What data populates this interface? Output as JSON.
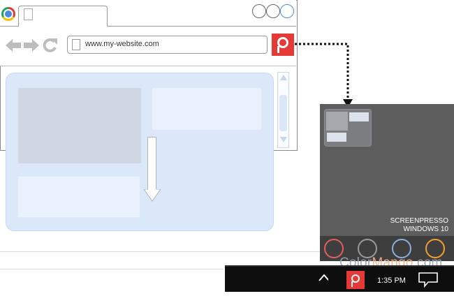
{
  "browser": {
    "url": "www.my-website.com",
    "window_buttons": [
      "minimize",
      "maximize",
      "close"
    ],
    "nav_icons": [
      "back-arrow-icon",
      "forward-arrow-icon",
      "reload-icon"
    ]
  },
  "notification": {
    "title_line1": "SCREENPRESSO",
    "title_line2": "WINDOWS 10",
    "action_colors": [
      "#e06060",
      "#9a9a9a",
      "#8aaee0",
      "#f0a030"
    ]
  },
  "watermark": {
    "part1": "Color",
    "part2": "Mango",
    "part3": ".com"
  },
  "taskbar": {
    "time": "1:35 PM"
  },
  "colors": {
    "accent": "#e53935",
    "capture_fill": "#dbe8f9",
    "panel_bg": "#5d5d5d"
  }
}
